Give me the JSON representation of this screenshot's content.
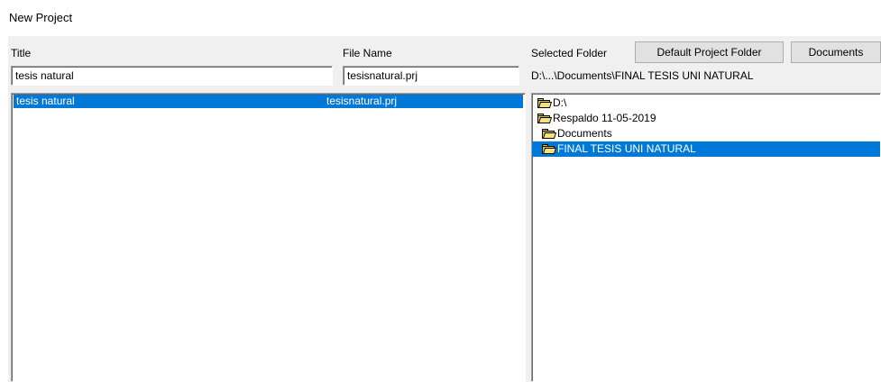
{
  "dialog": {
    "title": "New Project"
  },
  "labels": {
    "title": "Title",
    "file_name": "File Name",
    "selected_folder": "Selected Folder"
  },
  "buttons": {
    "default_project_folder": "Default Project Folder",
    "documents": "Documents"
  },
  "fields": {
    "title_value": "tesis natural",
    "file_name_value": "tesisnatural.prj",
    "selected_folder_path": "D:\\...\\Documents\\FINAL TESIS UNI NATURAL"
  },
  "projects": [
    {
      "title": "tesis natural",
      "file": "tesisnatural.prj",
      "selected": true
    }
  ],
  "folder_tree": [
    {
      "label": "D:\\",
      "level": 0,
      "icon": "folder-open-icon"
    },
    {
      "label": "Respaldo 11-05-2019",
      "level": 0,
      "icon": "folder-open-icon"
    },
    {
      "label": "Documents",
      "level": 1,
      "icon": "folder-open-icon"
    },
    {
      "label": "FINAL TESIS UNI NATURAL",
      "level": 1,
      "icon": "folder-open-icon",
      "selected": true
    }
  ],
  "colors": {
    "selection": "#0078d7",
    "panel": "#f0f0f0"
  }
}
